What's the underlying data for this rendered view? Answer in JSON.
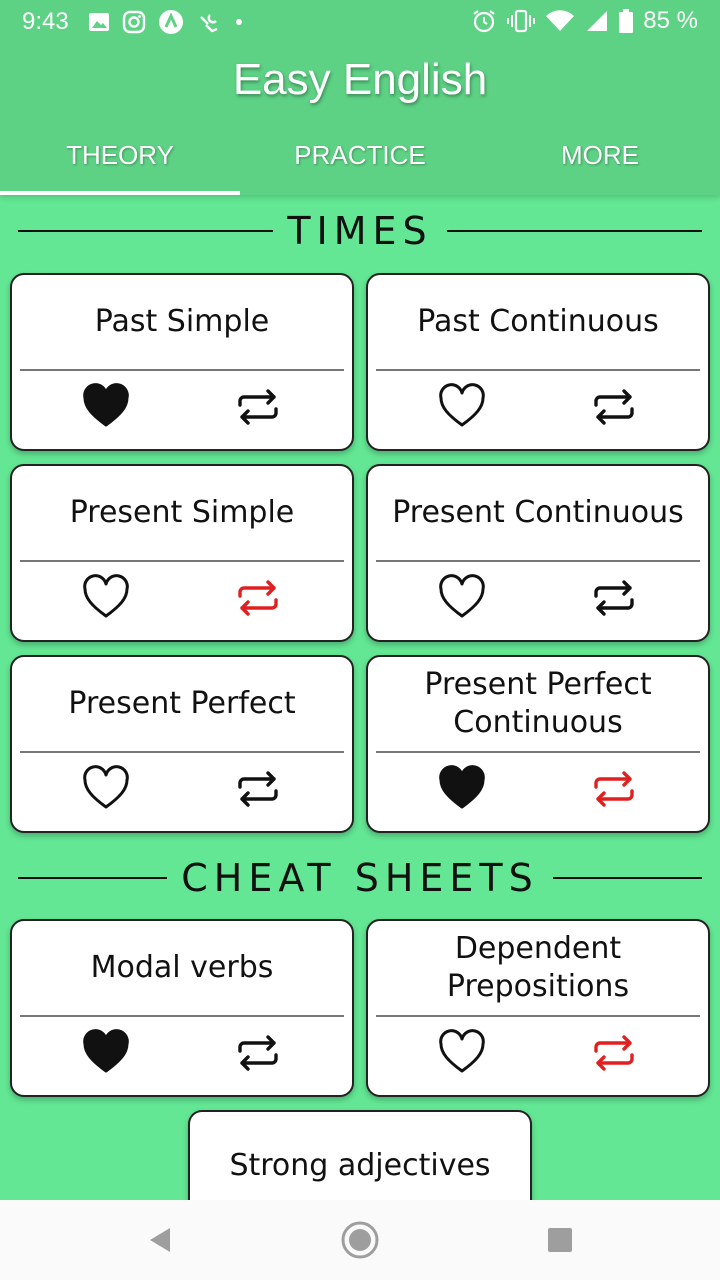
{
  "status_bar": {
    "time": "9:43",
    "battery_text": "85 %",
    "left_icons": [
      "image-icon",
      "instagram-icon",
      "app-icon",
      "wrench-icon",
      "dot-icon"
    ],
    "right_icons": [
      "alarm-icon",
      "vibrate-icon",
      "wifi-icon",
      "signal-icon",
      "battery-icon"
    ]
  },
  "app": {
    "title": "Easy English",
    "tabs": [
      {
        "label": "THEORY",
        "active": true
      },
      {
        "label": "PRACTICE",
        "active": false
      },
      {
        "label": "MORE",
        "active": false
      }
    ]
  },
  "sections": {
    "times": "TIMES",
    "cheat_sheets": "CHEAT SHEETS"
  },
  "times_cards": [
    {
      "title": "Past Simple",
      "favorite": true,
      "swap_highlight": false
    },
    {
      "title": "Past Continuous",
      "favorite": false,
      "swap_highlight": false
    },
    {
      "title": "Present Simple",
      "favorite": false,
      "swap_highlight": true
    },
    {
      "title": "Present Continuous",
      "favorite": false,
      "swap_highlight": false
    },
    {
      "title": "Present Perfect",
      "favorite": false,
      "swap_highlight": false
    },
    {
      "title": "Present Perfect Continuous",
      "favorite": true,
      "swap_highlight": true
    }
  ],
  "cheat_cards": [
    {
      "title": "Modal verbs",
      "favorite": true,
      "swap_highlight": false
    },
    {
      "title": "Dependent Prepositions",
      "favorite": false,
      "swap_highlight": true
    },
    {
      "title": "Strong adjectives"
    }
  ],
  "colors": {
    "header_bg": "#5dd184",
    "body_bg": "#63e794",
    "highlight_red": "#e02020",
    "icon_black": "#111111"
  },
  "nav": [
    "back-icon",
    "home-icon",
    "recents-icon"
  ]
}
